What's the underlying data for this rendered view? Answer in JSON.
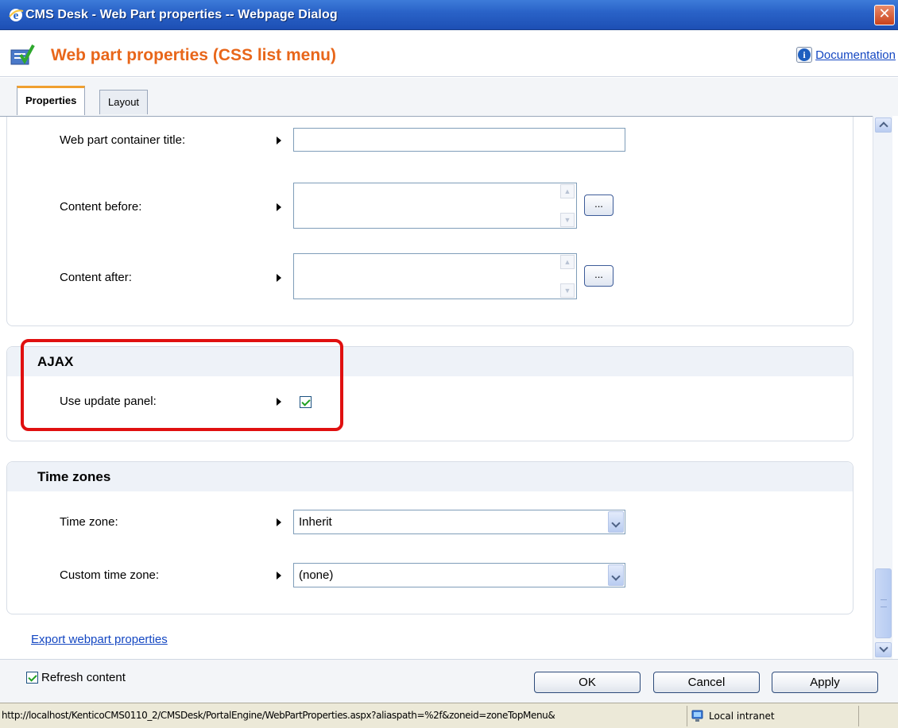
{
  "window": {
    "title": "CMS Desk - Web Part properties -- Webpage Dialog",
    "close": "✕"
  },
  "header": {
    "title": "Web part properties (CSS list menu)",
    "doc_link": "Documentation",
    "info_icon": "i"
  },
  "tabs": [
    {
      "label": "Properties",
      "active": true
    },
    {
      "label": "Layout",
      "active": false
    }
  ],
  "container": {
    "fields": [
      {
        "label": "Web part container title:",
        "value": ""
      },
      {
        "label": "Content before:",
        "value": "",
        "button": "..."
      },
      {
        "label": "Content after:",
        "value": "",
        "button": "..."
      }
    ]
  },
  "ajax": {
    "title": "AJAX",
    "field_label": "Use update panel:",
    "checked": true
  },
  "timezones": {
    "title": "Time zones",
    "zone_label": "Time zone:",
    "zone_value": "Inherit",
    "custom_label": "Custom time zone:",
    "custom_value": "(none)"
  },
  "export_link": "Export webpart properties",
  "footer": {
    "refresh_label": "Refresh content",
    "refresh_checked": true,
    "ok": "OK",
    "cancel": "Cancel",
    "apply": "Apply"
  },
  "status": {
    "url": "http://localhost/KenticoCMS0110_2/CMSDesk/PortalEngine/WebPartProperties.aspx?aliaspath=%2f&zoneid=zoneTopMenu&",
    "zone": "Local intranet"
  },
  "colors": {
    "accent_title": "#e8661a",
    "link": "#1447c2",
    "highlight": "#e01010",
    "titlebar": "#2a63c8"
  }
}
